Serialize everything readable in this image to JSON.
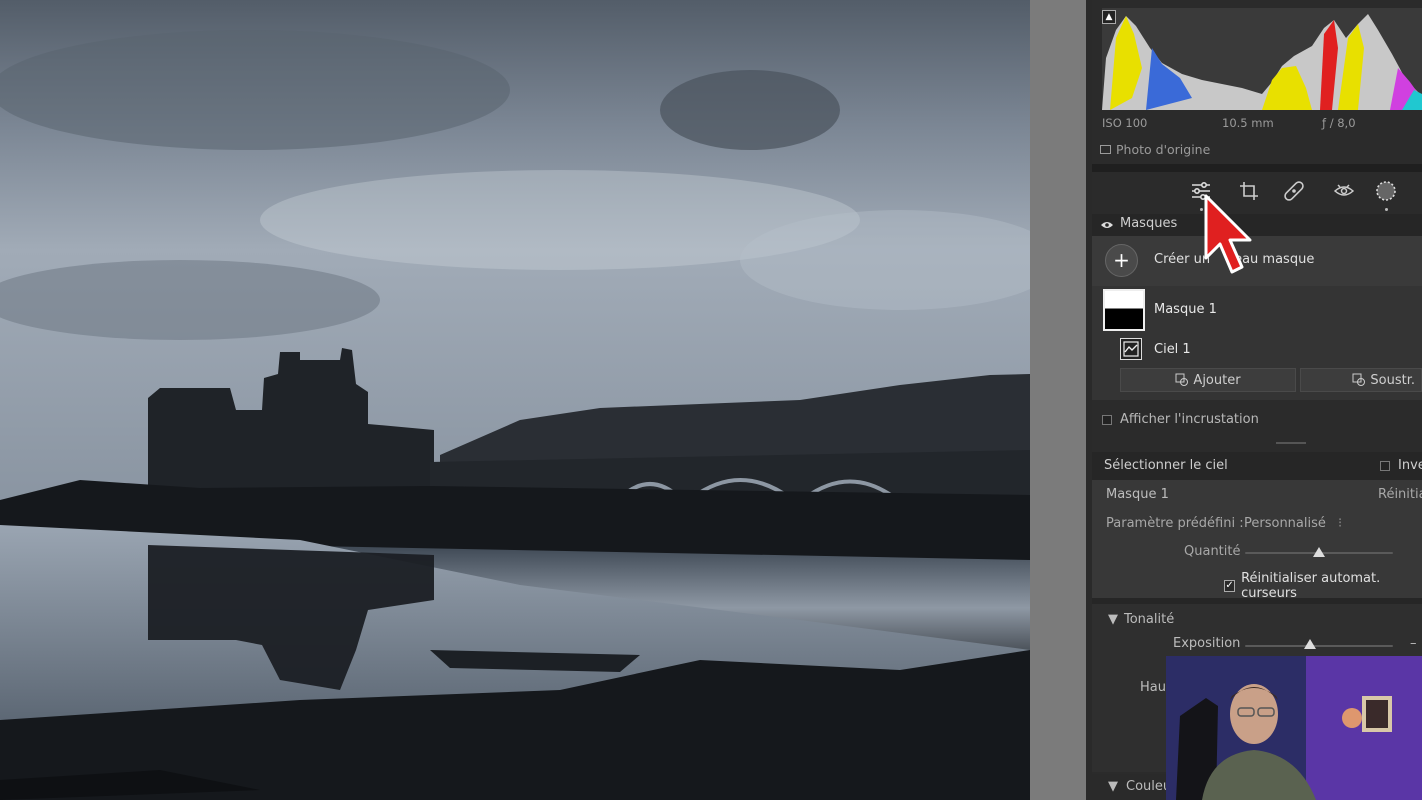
{
  "histogram": {
    "warning_glyph": "▲"
  },
  "camera_info": {
    "iso": "ISO 100",
    "focal_length": "10.5 mm",
    "aperture": "ƒ / 8,0"
  },
  "original_photo_label": "Photo d'origine",
  "toolbar": {
    "tools": [
      {
        "name": "edit-sliders-icon"
      },
      {
        "name": "crop-icon"
      },
      {
        "name": "healing-icon"
      },
      {
        "name": "red-eye-icon"
      },
      {
        "name": "masking-icon"
      }
    ]
  },
  "masks": {
    "header": "Masques",
    "create_label": "Créer un nouveau masque",
    "create_visible": "Créer un",
    "create_tail": "eau masque",
    "items": [
      {
        "name": "Masque 1"
      },
      {
        "name": "Ciel 1"
      }
    ],
    "add_label": "Ajouter",
    "subtract_label": "Soustr.",
    "show_overlay_label": "Afficher l'incrustation"
  },
  "select_sky": {
    "label": "Sélectionner le ciel",
    "invert_label": "Inve"
  },
  "mask_props": {
    "title": "Masque 1",
    "reset": "Réinitia",
    "preset_label": "Paramètre prédéfini :",
    "preset_value": "Personnalisé",
    "amount_label": "Quantité",
    "amount_value": 0.5,
    "auto_reset_label": "Réinitialiser automat. curseurs",
    "auto_reset_checked": true
  },
  "tone": {
    "header": "Tonalité",
    "exposure_label": "Exposition",
    "exposure_value_text": "–",
    "highlights_label": "Haut"
  },
  "color_section": {
    "header": "Couleu"
  },
  "colors": {
    "accent_red": "#e02020",
    "panel_bg": "#2b2b2b"
  }
}
